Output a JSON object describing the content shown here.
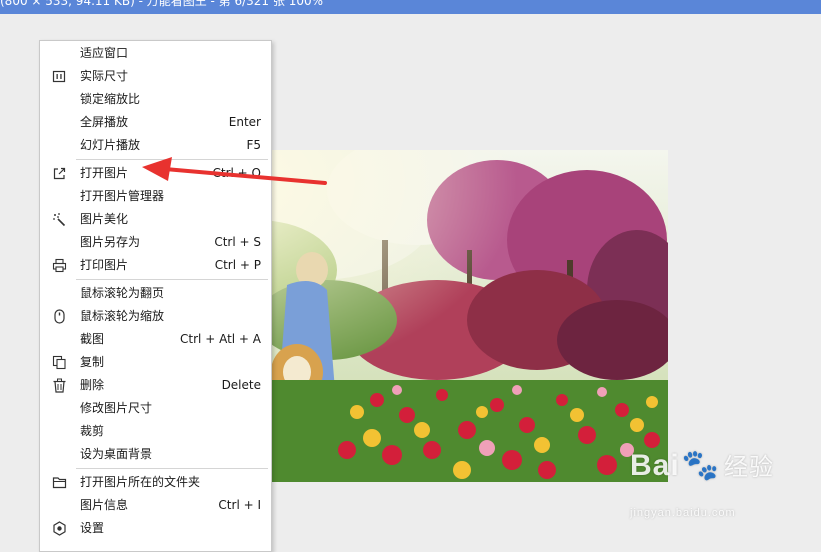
{
  "titlebar": {
    "text": "(800 × 533, 94.11 KB)  - 万能看图王 - 第 6/321 张 100%"
  },
  "context_menu": {
    "items": [
      {
        "label": "适应窗口",
        "shortcut": "",
        "icon": ""
      },
      {
        "label": "实际尺寸",
        "shortcut": "",
        "icon": "actual-size-icon"
      },
      {
        "label": "锁定缩放比",
        "shortcut": "",
        "icon": ""
      },
      {
        "label": "全屏播放",
        "shortcut": "Enter",
        "icon": ""
      },
      {
        "label": "幻灯片播放",
        "shortcut": "F5",
        "icon": ""
      },
      {
        "label": "打开图片",
        "shortcut": "Ctrl + O",
        "icon": "open-external-icon"
      },
      {
        "label": "打开图片管理器",
        "shortcut": "",
        "icon": ""
      },
      {
        "label": "图片美化",
        "shortcut": "",
        "icon": "magic-wand-icon"
      },
      {
        "label": "图片另存为",
        "shortcut": "Ctrl + S",
        "icon": ""
      },
      {
        "label": "打印图片",
        "shortcut": "Ctrl + P",
        "icon": "printer-icon"
      },
      {
        "label": "鼠标滚轮为翻页",
        "shortcut": "",
        "icon": ""
      },
      {
        "label": "鼠标滚轮为缩放",
        "shortcut": "",
        "icon": "mouse-icon"
      },
      {
        "label": "截图",
        "shortcut": "Ctrl + Atl + A",
        "icon": ""
      },
      {
        "label": "复制",
        "shortcut": "",
        "icon": "copy-icon"
      },
      {
        "label": "删除",
        "shortcut": "Delete",
        "icon": "trash-icon"
      },
      {
        "label": "修改图片尺寸",
        "shortcut": "",
        "icon": ""
      },
      {
        "label": "裁剪",
        "shortcut": "",
        "icon": ""
      },
      {
        "label": "设为桌面背景",
        "shortcut": "",
        "icon": ""
      },
      {
        "label": "打开图片所在的文件夹",
        "shortcut": "",
        "icon": "folder-icon"
      },
      {
        "label": "图片信息",
        "shortcut": "Ctrl + I",
        "icon": ""
      },
      {
        "label": "设置",
        "shortcut": "",
        "icon": "settings-icon"
      }
    ]
  },
  "annotation": {
    "arrow_color": "#e8322f"
  },
  "watermark": {
    "brand": "Bai",
    "brand_cn": "经验",
    "site": "jingyan.baidu.com"
  },
  "colors": {
    "titlebar": "#5a86d8",
    "background": "#ededed",
    "menu_bg": "#ffffff"
  }
}
